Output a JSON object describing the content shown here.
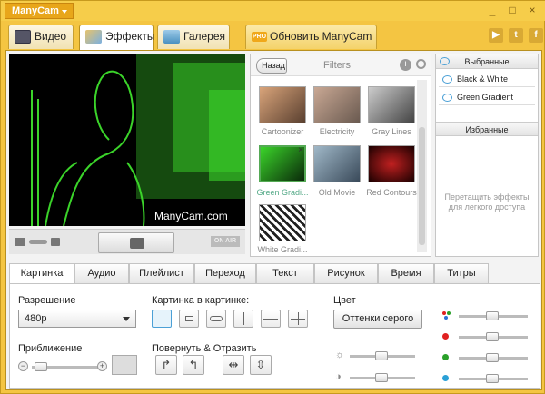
{
  "titlebar": {
    "app_menu": "ManyCam"
  },
  "main_tabs": {
    "video": "Видео",
    "effects": "Эффекты",
    "gallery": "Галерея",
    "upgrade": "Обновить ManyCam",
    "pro_badge": "PRO"
  },
  "social": {
    "youtube": "▶",
    "tumblr": "t",
    "facebook": "f"
  },
  "preview": {
    "watermark": "ManyCam.com",
    "on_air": "ON AIR"
  },
  "filters": {
    "back": "Назад",
    "title": "Filters",
    "items": [
      {
        "label": "Cartoonizer"
      },
      {
        "label": "Electricity"
      },
      {
        "label": "Gray Lines"
      },
      {
        "label": "Green Gradi..."
      },
      {
        "label": "Old Movie"
      },
      {
        "label": "Red Contours"
      },
      {
        "label": "White Gradi..."
      }
    ]
  },
  "sidebar": {
    "selected_header": "Выбранные",
    "selected": [
      {
        "label": "Black & White"
      },
      {
        "label": "Green Gradient"
      }
    ],
    "favorites_header": "Избранные",
    "hint": "Перетащить эффекты для легкого доступа"
  },
  "sub_tabs": [
    "Картинка",
    "Аудио",
    "Плейлист",
    "Переход",
    "Текст",
    "Рисунок",
    "Время",
    "Титры"
  ],
  "picture": {
    "resolution_label": "Разрешение",
    "resolution_value": "480p",
    "pip_label": "Картинка в картинке:",
    "zoom_label": "Приближение",
    "rotate_label": "Повернуть & Отразить",
    "color_label": "Цвет",
    "gray_button": "Оттенки серого",
    "zoom_minus": "−",
    "zoom_plus": "+"
  },
  "colors": {
    "accent": "#f4c542",
    "green_filter": "#3bd42a",
    "red": "#e02020",
    "green": "#2aa02a",
    "blue": "#2aa0d6"
  }
}
